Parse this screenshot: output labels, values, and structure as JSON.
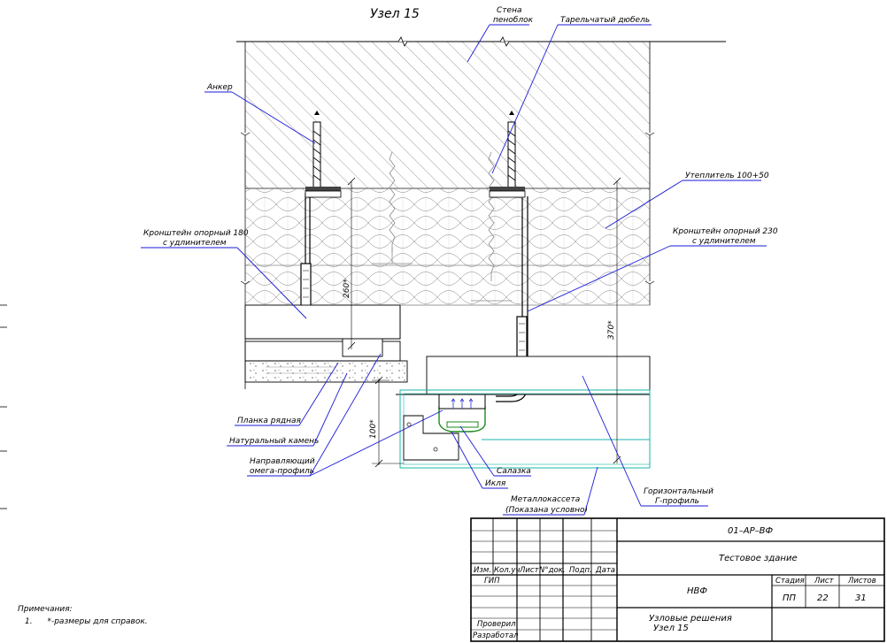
{
  "drawing": {
    "title": "Узел 15",
    "labels": {
      "wall": [
        "Стена",
        "пеноблок"
      ],
      "dowel": "Тарельчатый дюбель",
      "anchor": "Анкер",
      "insulation": "Утеплитель 100+50",
      "bracket_180": [
        "Кронштейн опорный 180",
        "с удлинителем"
      ],
      "bracket_230": [
        "Кронштейн опорный 230",
        "с удлинителем"
      ],
      "plank": "Планка рядная",
      "stone": "Натуральный камень",
      "omega": [
        "Направляющий",
        "омега-профиль"
      ],
      "slide": "Салазка",
      "hook": "Икля",
      "cassette": [
        "Металлокассета",
        "(Показана условно)"
      ],
      "g_profile": [
        "Горизонтальный",
        "Г-профиль"
      ]
    },
    "dims": {
      "d260": "260*",
      "d370": "370*",
      "d100": "100*"
    }
  },
  "title_block": {
    "code": "01–АР–ВФ",
    "object": "Тестовое здание",
    "section": "НВФ",
    "sheet_title": [
      "Узловые решения",
      "Узел 15"
    ],
    "col_headers": [
      "Изм.",
      "Кол.уч",
      "Лист",
      "N°док.",
      "Подп.",
      "Дата"
    ],
    "stage_label": "Стадия",
    "sheet_label": "Лист",
    "sheets_label": "Листов",
    "stage": "ПП",
    "sheet": "22",
    "sheets": "31",
    "roles": [
      "ГИП",
      "Проверил",
      "Разработал"
    ]
  },
  "notes": {
    "heading": "Примечания:",
    "items": [
      {
        "num": "1.",
        "text": "*-размеры для справок."
      }
    ]
  }
}
